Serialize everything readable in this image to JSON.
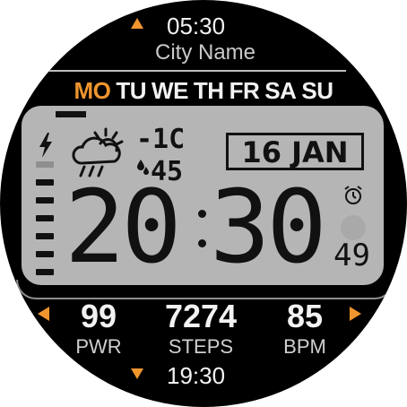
{
  "top": {
    "time": "05:30",
    "city": "City Name"
  },
  "weekdays": [
    {
      "label": "MO",
      "active": true
    },
    {
      "label": "TU",
      "active": false
    },
    {
      "label": "WE",
      "active": false
    },
    {
      "label": "TH",
      "active": false
    },
    {
      "label": "FR",
      "active": false
    },
    {
      "label": "SA",
      "active": false
    },
    {
      "label": "SU",
      "active": false
    }
  ],
  "weather": {
    "temp": "-1C",
    "humidity": "45",
    "icon": "cloud-sun-rain-icon"
  },
  "date": "16 JAN",
  "time": {
    "hours": "20",
    "minutes": "30",
    "seconds": "49"
  },
  "stats": [
    {
      "value": "99",
      "label": "PWR"
    },
    {
      "value": "7274",
      "label": "STEPS"
    },
    {
      "value": "85",
      "label": "BPM"
    }
  ],
  "bottom": {
    "time": "19:30"
  },
  "colors": {
    "accent": "#f0952e",
    "lcd": "#b5b5b5",
    "background": "#000000"
  }
}
